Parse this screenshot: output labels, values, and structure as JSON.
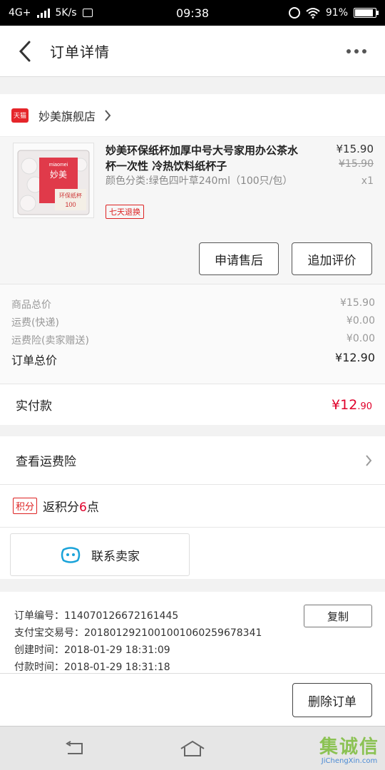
{
  "status_bar": {
    "network": "4G+",
    "speed": "5K/s",
    "time": "09:38",
    "battery": "91%",
    "battery_level": 0.91
  },
  "nav": {
    "title": "订单详情",
    "back_icon": "chevron-left-icon",
    "more_icon": "more-dots-icon"
  },
  "shop": {
    "badge": "天猫",
    "name": "妙美旗舰店"
  },
  "product": {
    "title": "妙美环保纸杯加厚中号大号家用办公茶水杯一次性 冷热饮料纸杯子",
    "spec": "颜色分类:绿色四叶草240ml（100只/包）",
    "tag": "七天退换",
    "price": "¥15.90",
    "original_price": "¥15.90",
    "quantity": "x1",
    "image_brand": "miaomei",
    "image_brand_cn": "妙美",
    "image_label": "环保纸杯",
    "image_count": "100"
  },
  "actions": {
    "after_sales": "申请售后",
    "add_review": "追加评价"
  },
  "summary": {
    "rows": [
      {
        "label": "商品总价",
        "value": "¥15.90"
      },
      {
        "label": "运费(快递)",
        "value": "¥0.00"
      },
      {
        "label": "运费险(卖家赠送)",
        "value": "¥0.00"
      }
    ],
    "total_label": "订单总价",
    "total_value": "¥12.90"
  },
  "paid": {
    "label": "实付款",
    "currency": "¥",
    "amount_int": "12",
    "amount_dec": ".90"
  },
  "shipping_insurance": {
    "label": "查看运费险"
  },
  "points": {
    "badge": "积分",
    "prefix": "返积分",
    "value": "6",
    "suffix": "点"
  },
  "contact": {
    "label": "联系卖家"
  },
  "order_info": {
    "order_no": "订单编号：114070126672161445",
    "alipay_no": "支付宝交易号：2018012921001001060259678341",
    "created": "创建时间：2018-01-29 18:31:09",
    "paid_time": "付款时间：2018-01-29 18:31:18",
    "copy_label": "复制"
  },
  "footer": {
    "delete_label": "删除订单"
  },
  "watermark": {
    "main": "集诚信",
    "sub": "JiChengXin.com"
  },
  "colors": {
    "accent_red": "#e0002a",
    "tmall_red": "#e5252a",
    "watermark_green": "#7cbc3a"
  }
}
